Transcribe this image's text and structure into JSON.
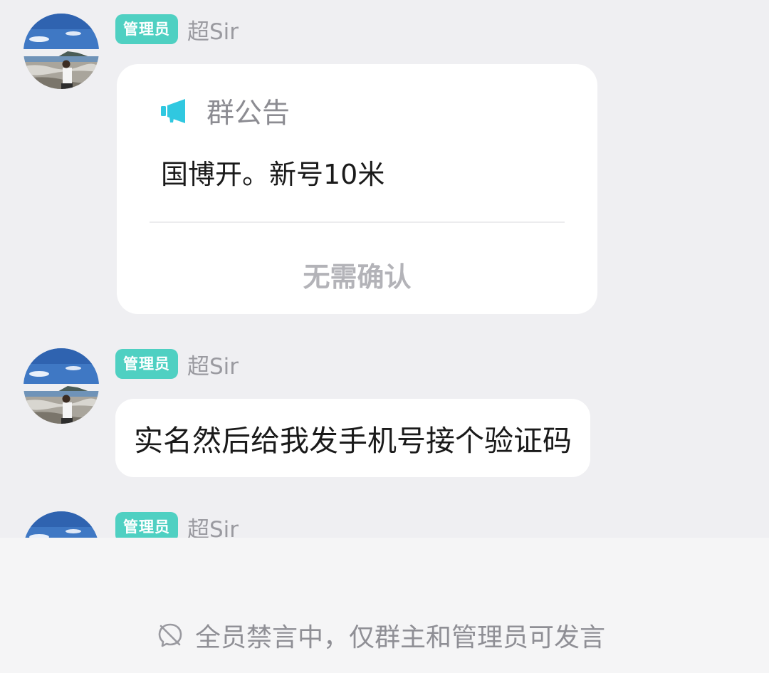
{
  "messages": [
    {
      "role_badge": "管理员",
      "nickname": "超Sir"
    },
    {
      "role_badge": "管理员",
      "nickname": "超Sir",
      "text": "实名然后给我发手机号接个验证码"
    },
    {
      "role_badge": "管理员",
      "nickname": "超Sir"
    }
  ],
  "notice": {
    "icon": "megaphone-icon",
    "title": "群公告",
    "body": "国博开。新号10米",
    "confirm_label": "无需确认"
  },
  "footer": {
    "mute_icon": "mute-icon",
    "mute_text": "全员禁言中，仅群主和管理员可发言"
  },
  "colors": {
    "badge": "#4fd0c2",
    "megaphone": "#30c8e0",
    "background": "#efeff2"
  }
}
